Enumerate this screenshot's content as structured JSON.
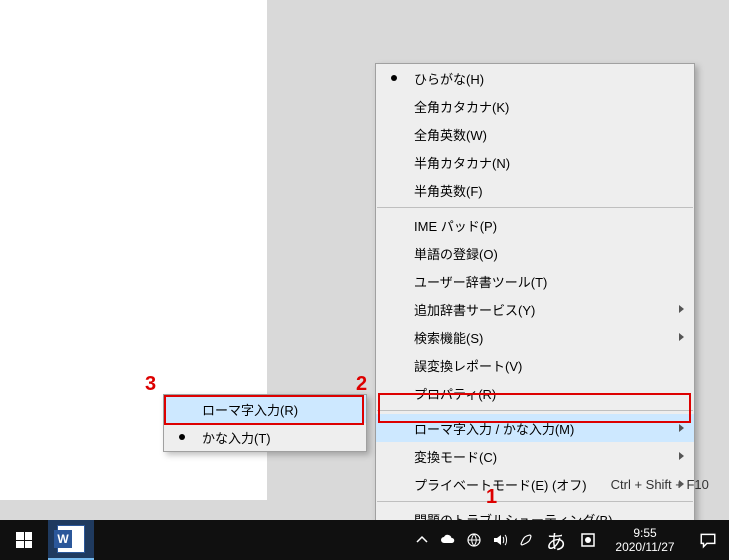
{
  "menu": {
    "items": [
      {
        "label": "ひらがな(H)",
        "radio": true
      },
      {
        "label": "全角カタカナ(K)"
      },
      {
        "label": "全角英数(W)"
      },
      {
        "label": "半角カタカナ(N)"
      },
      {
        "label": "半角英数(F)"
      },
      {
        "sep": true
      },
      {
        "label": "IME パッド(P)"
      },
      {
        "label": "単語の登録(O)"
      },
      {
        "label": "ユーザー辞書ツール(T)"
      },
      {
        "label": "追加辞書サービス(Y)",
        "sub": true
      },
      {
        "label": "検索機能(S)",
        "sub": true
      },
      {
        "label": "誤変換レポート(V)"
      },
      {
        "label": "プロパティ(R)"
      },
      {
        "sep": true
      },
      {
        "label": "ローマ字入力 / かな入力(M)",
        "sub": true,
        "selected": true
      },
      {
        "label": "変換モード(C)",
        "sub": true
      },
      {
        "label": "プライベートモード(E) (オフ)",
        "sub": true,
        "accel": "Ctrl + Shift + F10"
      },
      {
        "sep": true
      },
      {
        "label": "問題のトラブルシューティング(B)"
      }
    ]
  },
  "submenu": {
    "items": [
      {
        "label": "ローマ字入力(R)",
        "selected": true
      },
      {
        "label": "かな入力(T)",
        "radio": true
      }
    ]
  },
  "taskbar": {
    "ime": "あ",
    "clock_time": "9:55",
    "clock_date": "2020/11/27",
    "word_letter": "W"
  },
  "annotations": {
    "a1": "1",
    "a2": "2",
    "a3": "3"
  }
}
